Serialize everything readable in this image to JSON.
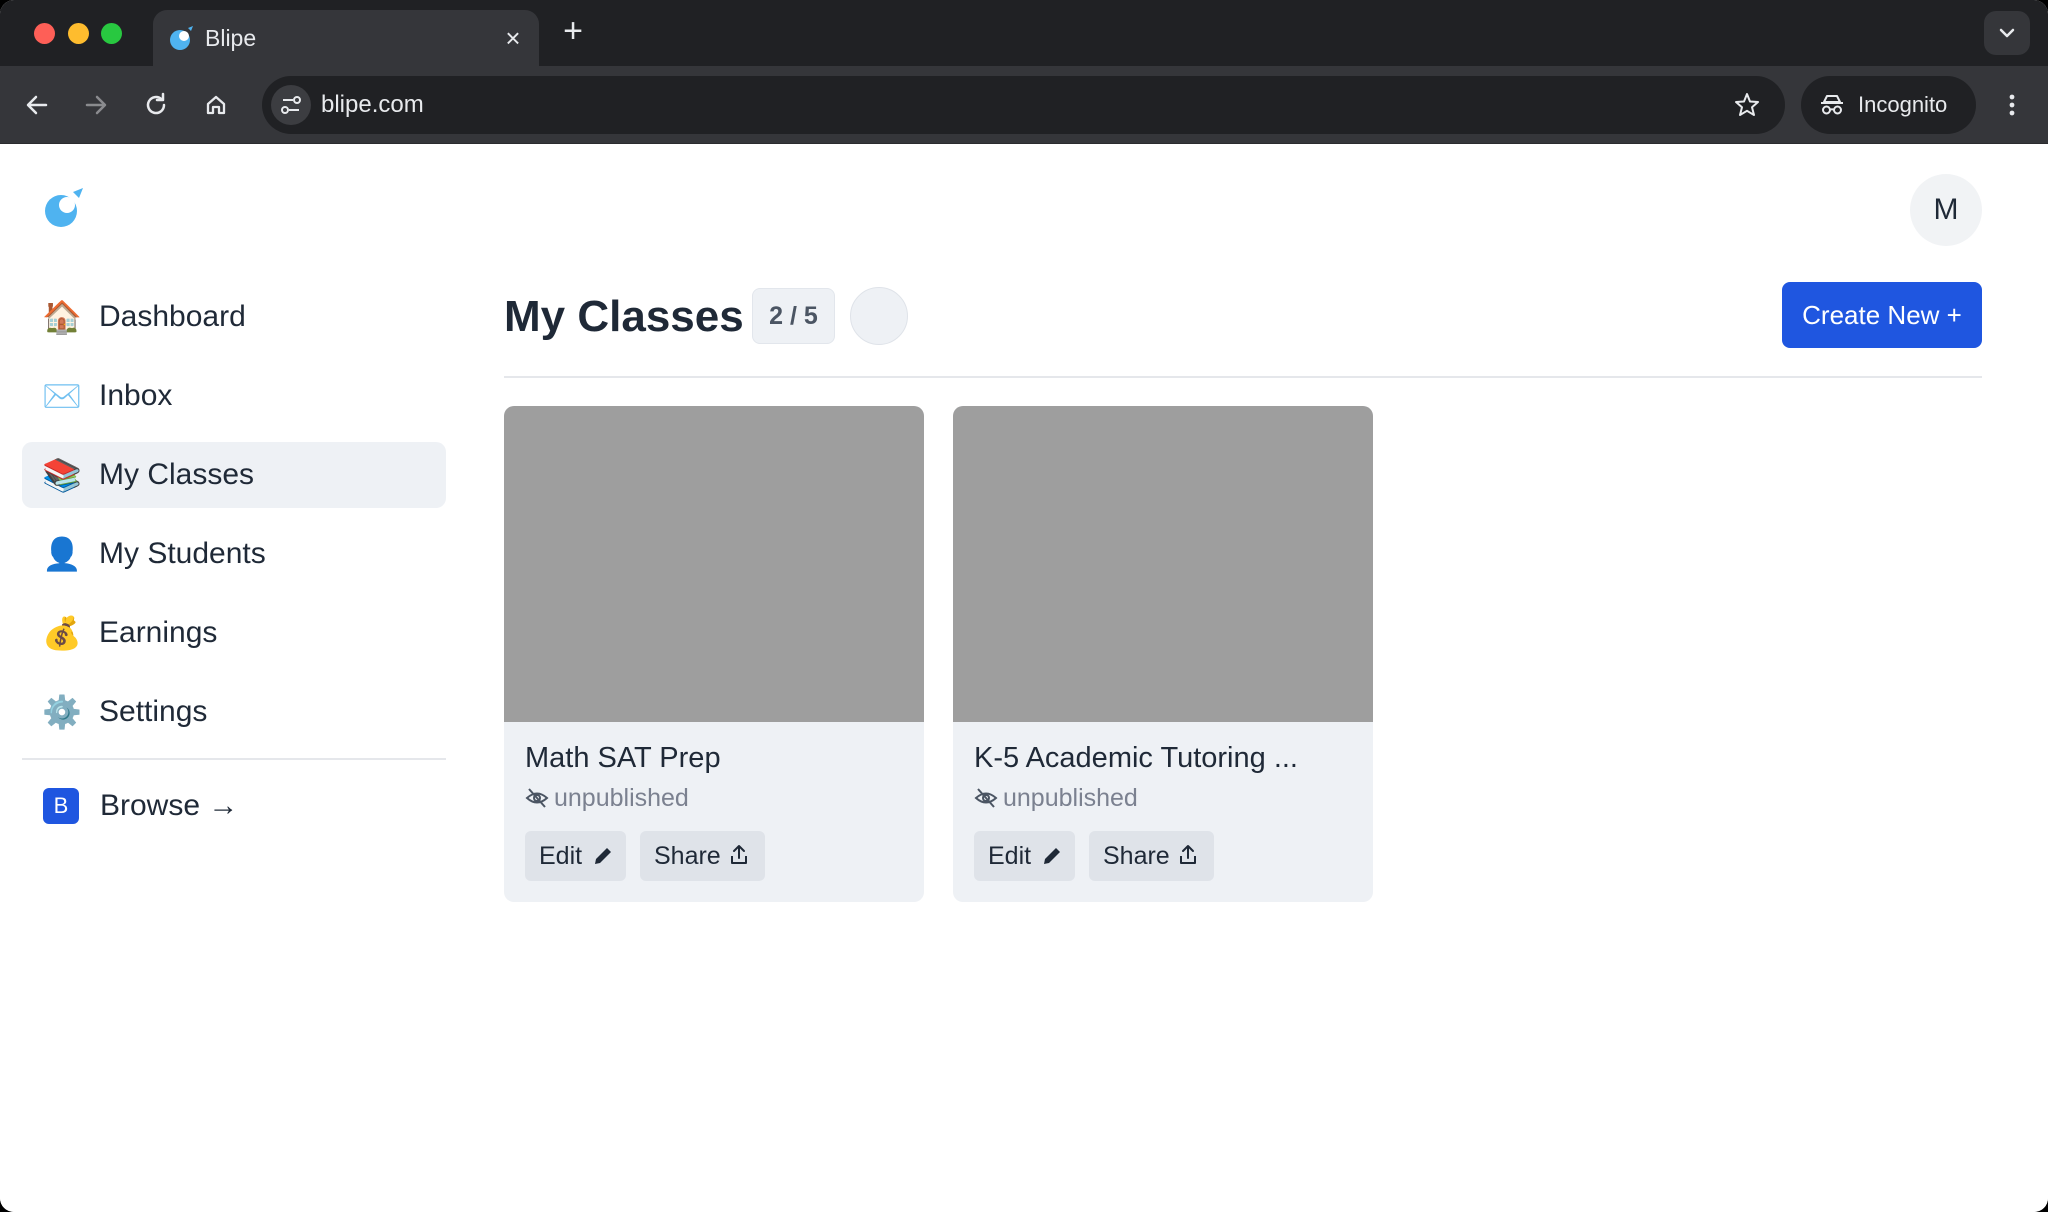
{
  "browser": {
    "tab_title": "Blipe",
    "tab_close": "×",
    "new_tab": "+",
    "url": "blipe.com",
    "incognito_label": "Incognito"
  },
  "user": {
    "avatar_initial": "M"
  },
  "sidebar": {
    "items": [
      {
        "label": "Dashboard",
        "emoji": "🏠",
        "icon": "house-icon",
        "active": false
      },
      {
        "label": "Inbox",
        "emoji": "✉️",
        "icon": "envelope-icon",
        "active": false
      },
      {
        "label": "My Classes",
        "emoji": "📚",
        "icon": "books-icon",
        "active": true
      },
      {
        "label": "My Students",
        "emoji": "👤",
        "icon": "person-icon",
        "active": false
      },
      {
        "label": "Earnings",
        "emoji": "💰",
        "icon": "money-bag-icon",
        "active": false
      },
      {
        "label": "Settings",
        "emoji": "⚙️",
        "icon": "gear-icon",
        "active": false
      }
    ],
    "browse": {
      "badge": "B",
      "label": "Browse →"
    }
  },
  "main": {
    "title": "My Classes",
    "count": "2 / 5",
    "create_label": "Create New +"
  },
  "classes": [
    {
      "title": "Math SAT Prep",
      "status": "unpublished",
      "edit_label": "Edit",
      "share_label": "Share"
    },
    {
      "title": "K-5 Academic Tutoring ...",
      "status": "unpublished",
      "edit_label": "Edit",
      "share_label": "Share"
    }
  ],
  "colors": {
    "accent": "#1f56e0",
    "chrome_dark": "#202124",
    "chrome_toolbar": "#35363a",
    "active_item_bg": "#eef1f5",
    "thumbnail_placeholder": "#9e9e9e"
  }
}
